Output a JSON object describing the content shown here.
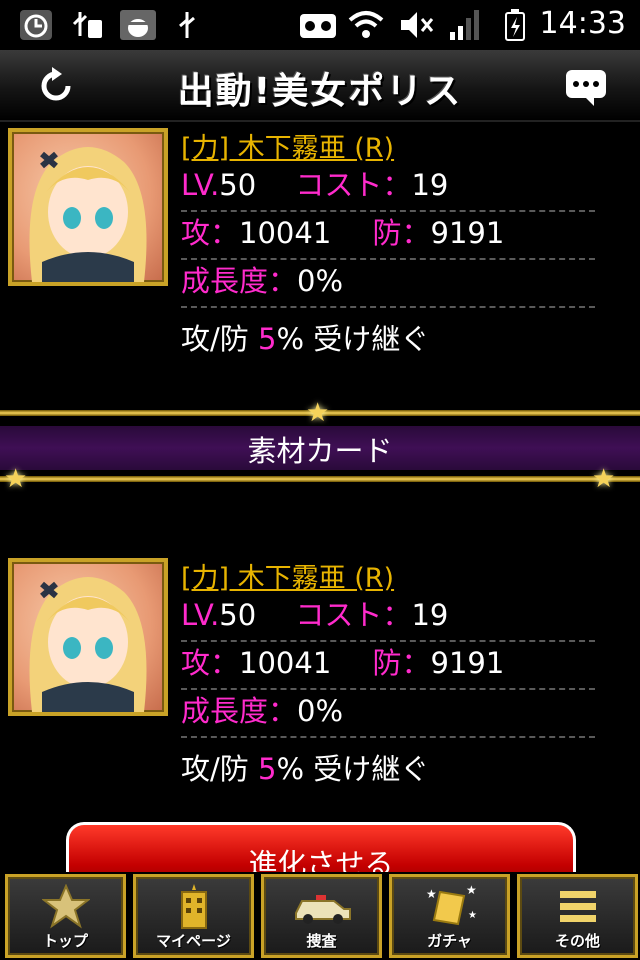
{
  "status_bar": {
    "time": "14:33",
    "left_icons": [
      "alarm-icon",
      "usb-debug-icon",
      "sd-card-icon",
      "android-debug-icon",
      "usb-icon"
    ],
    "right_icons": [
      "voicemail-icon",
      "wifi-icon",
      "mute-icon",
      "signal-icon",
      "battery-icon"
    ]
  },
  "header": {
    "title": "出動!美女ポリス",
    "reload_icon": "reload-icon",
    "chat_icon": "chat-icon"
  },
  "base_card": {
    "name": "[力] 木下霧亜 (R)",
    "lv_label": "LV.",
    "lv_value": "50",
    "cost_label": "コスト：",
    "cost_value": "19",
    "atk_label": "攻：",
    "atk_value": "10041",
    "def_label": "防：",
    "def_value": "9191",
    "growth_label": "成長度：",
    "growth_value": "0%",
    "inherit_prefix": "攻/防 ",
    "inherit_value": "5",
    "inherit_suffix": "% 受け継ぐ"
  },
  "divider": {
    "label": "素材カード"
  },
  "material_card": {
    "name": "[力] 木下霧亜 (R)",
    "lv_label": "LV.",
    "lv_value": "50",
    "cost_label": "コスト：",
    "cost_value": "19",
    "atk_label": "攻：",
    "atk_value": "10041",
    "def_label": "防：",
    "def_value": "9191",
    "growth_label": "成長度：",
    "growth_value": "0%",
    "inherit_prefix": "攻/防 ",
    "inherit_value": "5",
    "inherit_suffix": "% 受け継ぐ"
  },
  "evolve_button": {
    "label": "進化させる"
  },
  "bottom_nav": {
    "items": [
      {
        "label": "トップ",
        "icon": "police-badge-icon"
      },
      {
        "label": "マイページ",
        "icon": "building-icon"
      },
      {
        "label": "捜査",
        "icon": "police-car-icon"
      },
      {
        "label": "ガチャ",
        "icon": "gacha-card-icon"
      },
      {
        "label": "その他",
        "icon": "menu-icon"
      }
    ]
  },
  "colors": {
    "accent_gold": "#e8b400",
    "stat_label_magenta": "#ff2bcc",
    "divider_purple": "#3f0f55",
    "button_red": "#c40000"
  }
}
